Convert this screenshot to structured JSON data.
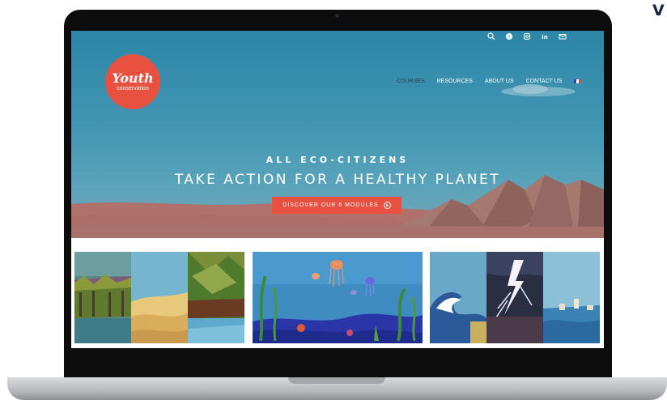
{
  "corner_letter": "V",
  "site": {
    "logo": {
      "word": "Youth",
      "sub": "conservation"
    },
    "topbar_icons": [
      "search-icon",
      "facebook-icon",
      "instagram-icon",
      "linkedin-icon",
      "mail-icon"
    ],
    "nav": [
      "COURSES",
      "RESOURCES",
      "ABOUT US",
      "CONTACT US"
    ],
    "nav_flag": "french-flag-icon",
    "hero": {
      "subtitle": "ALL ECO-CITIZENS",
      "title": "TAKE ACTION FOR A HEALTHY PLANET",
      "cta": "DISCOVER OUR 6 MODULES"
    },
    "cards": [
      {
        "name": "land-ecosystems-card"
      },
      {
        "name": "ocean-ecosystems-card"
      },
      {
        "name": "climate-events-card"
      }
    ]
  },
  "colors": {
    "accent": "#e8513f",
    "sky": "#3f95b2",
    "nav_active": "#2a3e52",
    "bezel": "#0c0c0d"
  }
}
